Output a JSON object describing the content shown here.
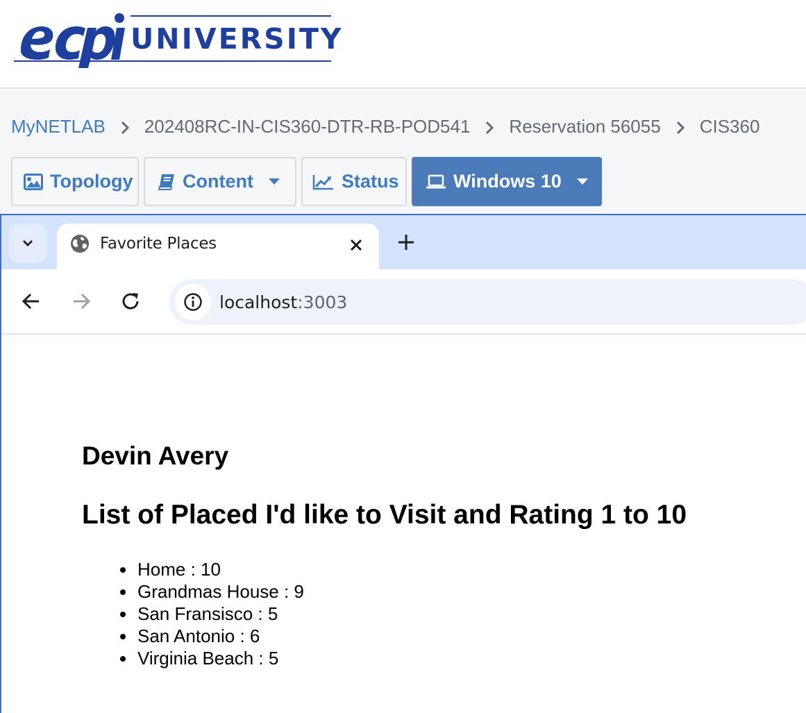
{
  "brand": {
    "wordmark": "ecpi",
    "name": "UNIVERSITY",
    "color": "#1f3f9c"
  },
  "breadcrumb": [
    "MyNETLAB",
    "202408RC-IN-CIS360-DTR-RB-POD541",
    "Reservation 56055",
    "CIS360"
  ],
  "tabs": [
    {
      "label": "Topology",
      "icon": "image-icon",
      "has_dropdown": false
    },
    {
      "label": "Content",
      "icon": "book-icon",
      "has_dropdown": true
    },
    {
      "label": "Status",
      "icon": "line-chart-icon",
      "has_dropdown": false
    },
    {
      "label": "Windows 10",
      "icon": "laptop-icon",
      "has_dropdown": true,
      "active": true
    }
  ],
  "browser": {
    "tab_title": "Favorite Places",
    "url_host": "localhost",
    "url_port": ":3003"
  },
  "page": {
    "name": "Devin Avery",
    "heading": "List of Placed I'd like to Visit and Rating 1 to 10",
    "places": [
      "Home : 10",
      "Grandmas House : 9",
      "San Fransisco : 5",
      "San Antonio : 6",
      "Virginia Beach : 5"
    ]
  },
  "colors": {
    "link": "#3f7bc0",
    "active_tab": "#4a7ab8",
    "browser_frame": "#d3e3fd"
  }
}
